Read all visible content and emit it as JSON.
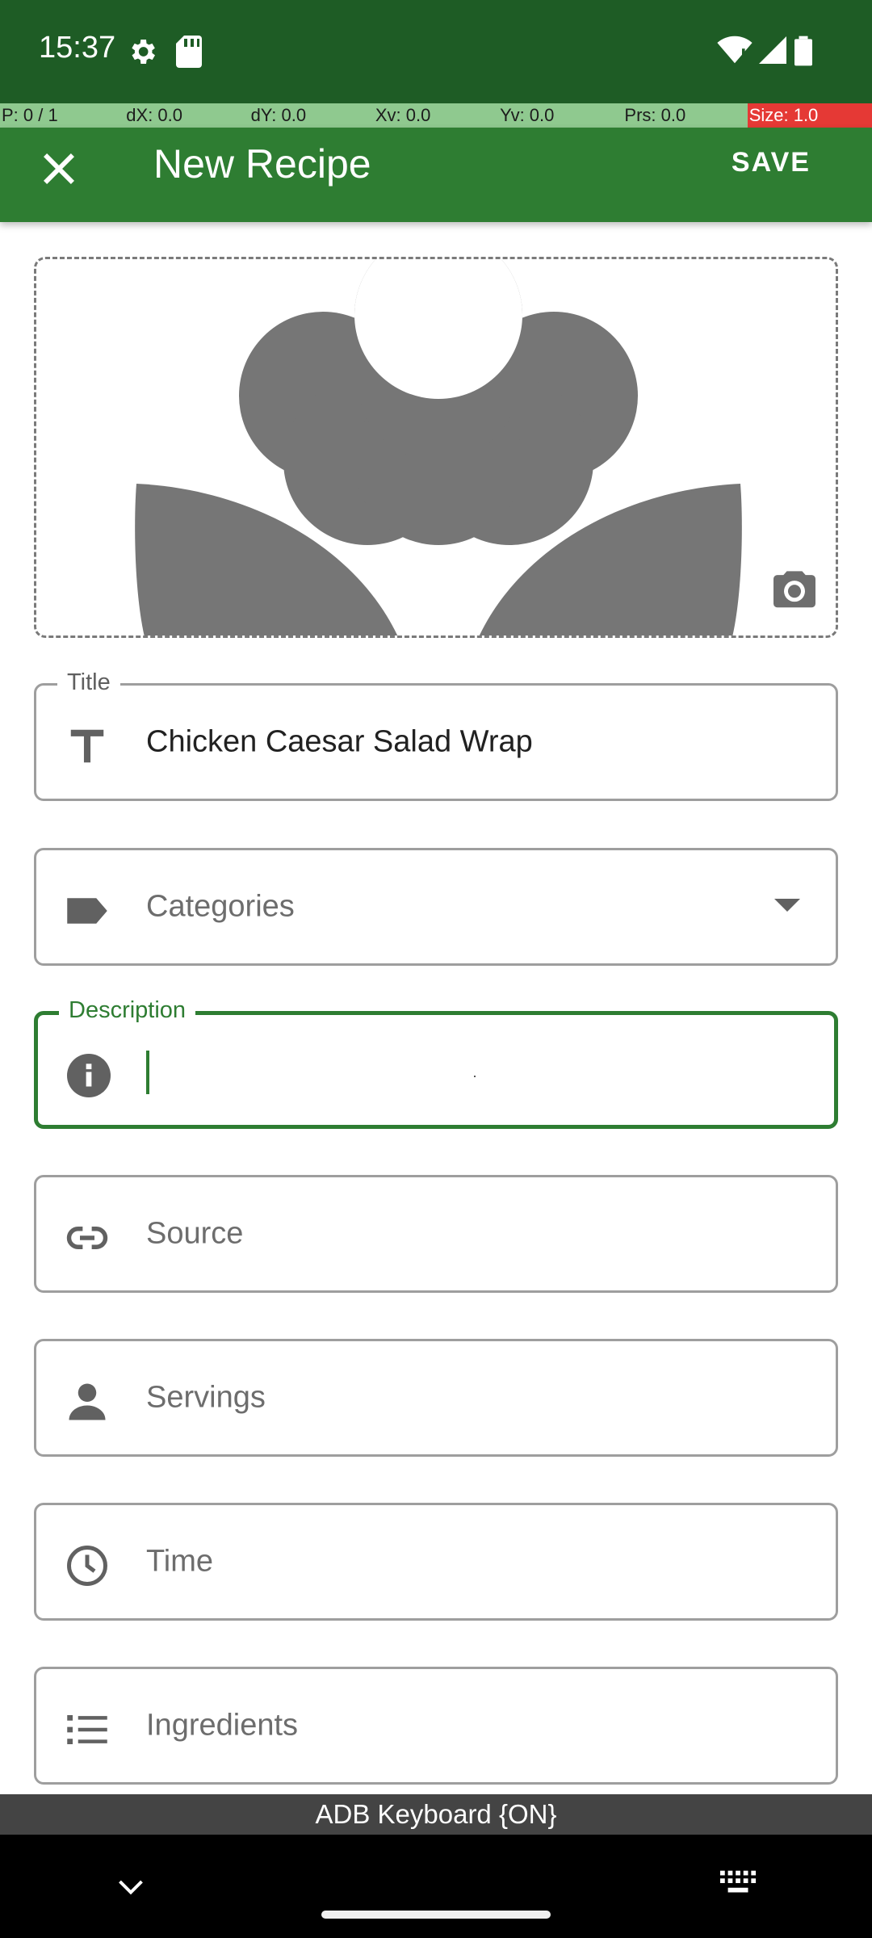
{
  "status": {
    "time": "15:37",
    "icons": [
      "settings-icon",
      "sd-card-icon",
      "wifi-icon",
      "signal-icon",
      "battery-icon"
    ]
  },
  "pointer": {
    "p": "P: 0 / 1",
    "dx": "dX: 0.0",
    "dy": "dY: 0.0",
    "xv": "Xv: 0.0",
    "yv": "Yv: 0.0",
    "prs": "Prs: 0.0",
    "size": "Size: 1.0"
  },
  "app_bar": {
    "title": "New Recipe",
    "save_label": "SAVE",
    "close_icon": "close-icon"
  },
  "image": {
    "placeholder_icon": "flower-image-icon",
    "camera_icon": "camera-icon"
  },
  "form": {
    "title": {
      "label": "Title",
      "value": "Chicken Caesar Salad Wrap",
      "icon": "text-t-icon"
    },
    "categories": {
      "placeholder": "Categories",
      "icon": "label-tag-icon"
    },
    "description": {
      "label": "Description",
      "value": "",
      "icon": "info-icon"
    },
    "source": {
      "placeholder": "Source",
      "icon": "link-icon"
    },
    "servings": {
      "placeholder": "Servings",
      "icon": "person-icon"
    },
    "time": {
      "placeholder": "Time",
      "icon": "clock-icon"
    },
    "ingredients": {
      "placeholder": "Ingredients",
      "icon": "list-icon"
    }
  },
  "keyboard_bar": {
    "text": "ADB Keyboard {ON}"
  },
  "colors": {
    "status_bar": "#1e5c25",
    "app_bar": "#2e7d32",
    "accent": "#2e7d32",
    "pointer_bar": "#8fc98f",
    "pointer_size": "#e53935"
  }
}
